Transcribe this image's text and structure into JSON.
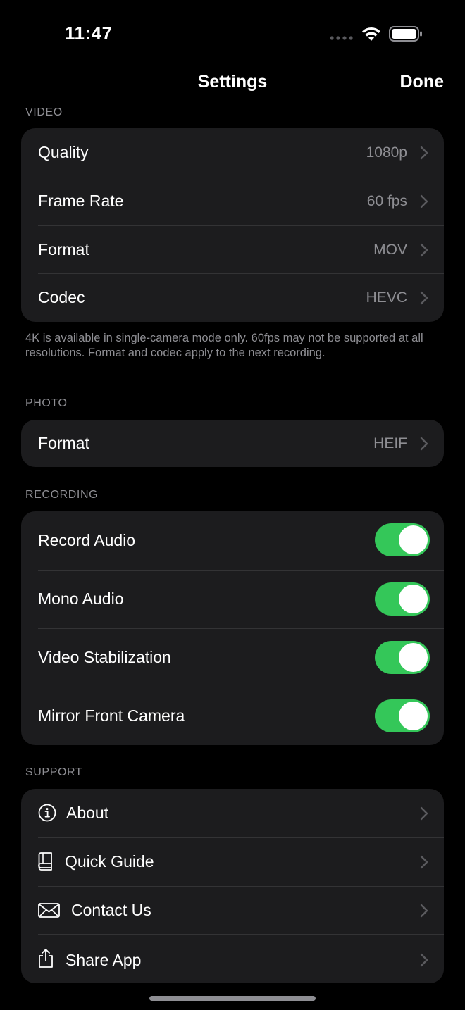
{
  "status_bar": {
    "time": "11:47"
  },
  "nav": {
    "title": "Settings",
    "done_label": "Done"
  },
  "video": {
    "header": "VIDEO",
    "rows": [
      {
        "label": "Quality",
        "value": "1080p"
      },
      {
        "label": "Frame Rate",
        "value": "60 fps"
      },
      {
        "label": "Format",
        "value": "MOV"
      },
      {
        "label": "Codec",
        "value": "HEVC"
      }
    ],
    "footer": "4K is available in single-camera mode only. 60fps may not be supported at all resolutions. Format and codec apply to the next recording."
  },
  "photo": {
    "header": "PHOTO",
    "rows": [
      {
        "label": "Format",
        "value": "HEIF"
      }
    ]
  },
  "recording": {
    "header": "RECORDING",
    "rows": [
      {
        "label": "Record Audio",
        "on": true
      },
      {
        "label": "Mono Audio",
        "on": true
      },
      {
        "label": "Video Stabilization",
        "on": true
      },
      {
        "label": "Mirror Front Camera",
        "on": true
      }
    ]
  },
  "support": {
    "header": "SUPPORT",
    "rows": [
      {
        "label": "About",
        "icon": "info-icon"
      },
      {
        "label": "Quick Guide",
        "icon": "book-icon"
      },
      {
        "label": "Contact Us",
        "icon": "envelope-icon"
      },
      {
        "label": "Share App",
        "icon": "share-icon"
      }
    ]
  },
  "colors": {
    "toggle_on": "#34c759",
    "group_bg": "#1c1c1e",
    "secondary_text": "#8e8e93"
  }
}
